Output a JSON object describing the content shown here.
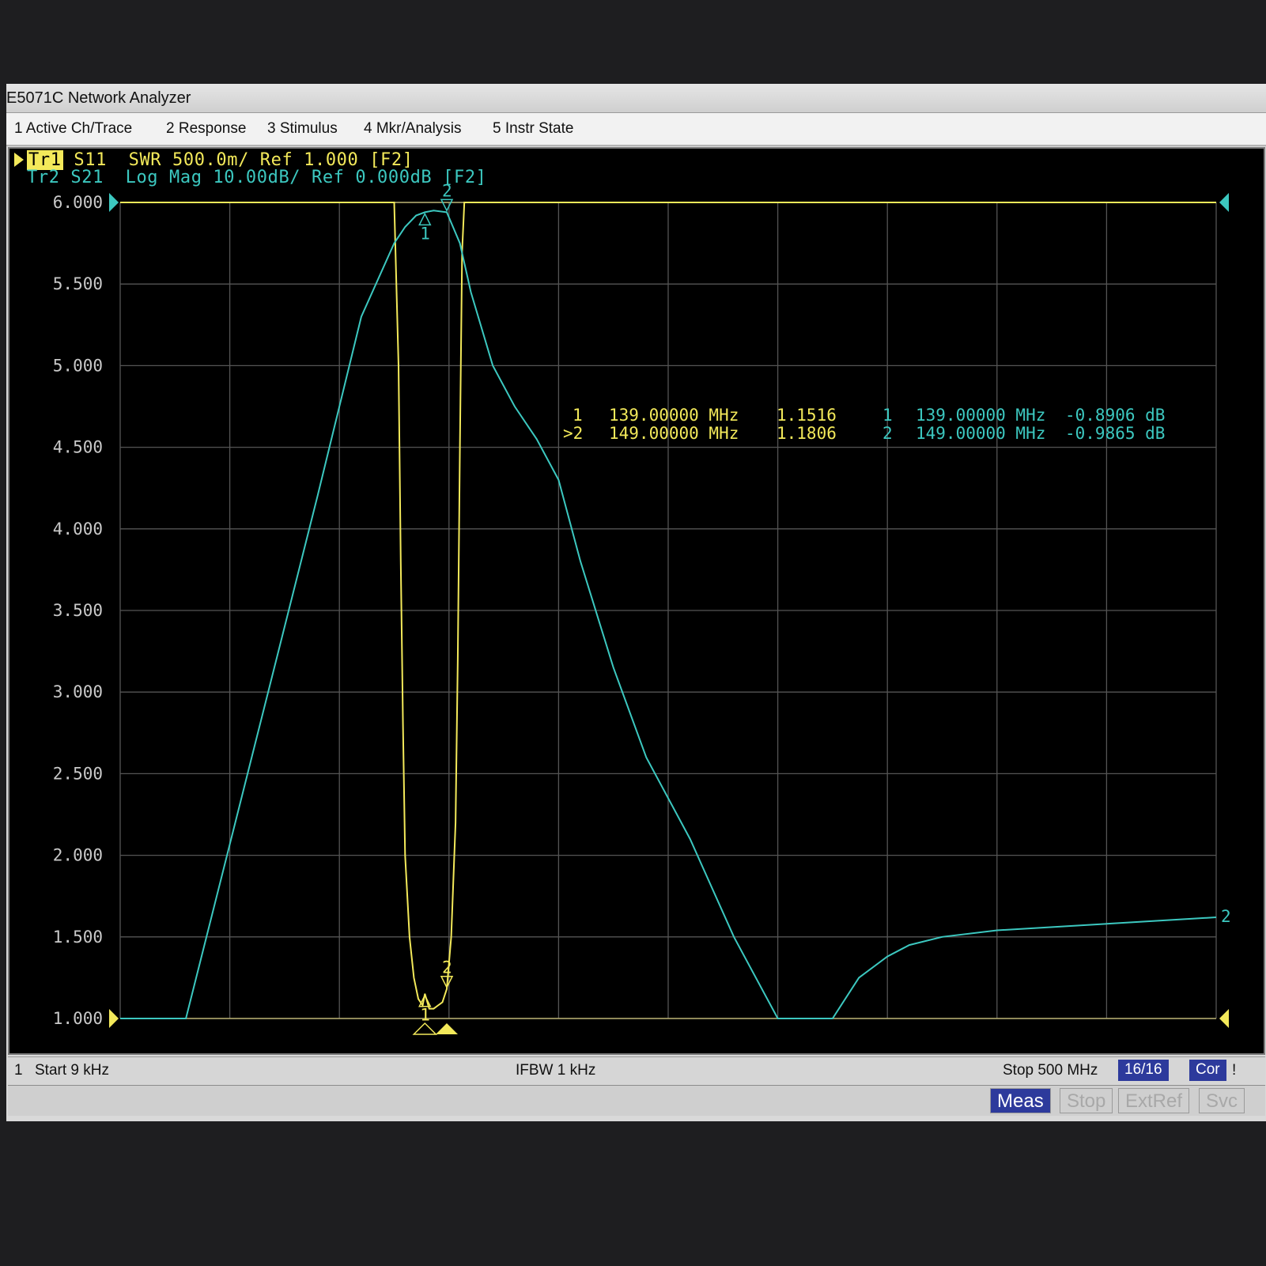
{
  "window": {
    "title": "E5071C Network Analyzer"
  },
  "menu": [
    {
      "label": "1 Active Ch/Trace"
    },
    {
      "label": "2 Response"
    },
    {
      "label": "3 Stimulus"
    },
    {
      "label": "4 Mkr/Analysis"
    },
    {
      "label": "5 Instr State"
    }
  ],
  "traces": {
    "tr1": {
      "tag": "Tr1",
      "text": " S11  SWR 500.0m/ Ref 1.000 [F2]"
    },
    "tr2": {
      "tag": "Tr2",
      "text": " S21  Log Mag 10.00dB/ Ref 0.000dB [F2]"
    }
  },
  "colors": {
    "tr1": "#f3e95a",
    "tr2": "#3cc8c0",
    "grid": "#5a5a5a",
    "background": "#000000",
    "chip": "#2d3a9c"
  },
  "markers_table": {
    "tr1": [
      {
        "id": "1",
        "freq": "139.00000 MHz",
        "value": "1.1516"
      },
      {
        "id": ">2",
        "freq": "149.00000 MHz",
        "value": "1.1806"
      }
    ],
    "tr2": [
      {
        "id": "1",
        "freq": "139.00000 MHz",
        "value": "-0.8906 dB"
      },
      {
        "id": "2",
        "freq": "149.00000 MHz",
        "value": "-0.9865 dB"
      }
    ]
  },
  "status": {
    "channel": "1",
    "start": "Start 9 kHz",
    "ifbw": "IFBW 1 kHz",
    "stop": "Stop 500 MHz",
    "points": "16/16",
    "cor": "Cor",
    "extra": "!"
  },
  "softkeys": [
    {
      "label": "Meas",
      "active": true
    },
    {
      "label": "Stop",
      "active": false
    },
    {
      "label": "ExtRef",
      "active": false
    },
    {
      "label": "Svc",
      "active": false
    }
  ],
  "chart_data": {
    "type": "line",
    "xlim": [
      0.009,
      500
    ],
    "ylim": [
      1.0,
      6.0
    ],
    "y_ticks": [
      "6.000",
      "5.500",
      "5.000",
      "4.500",
      "4.000",
      "3.500",
      "3.000",
      "2.500",
      "2.000",
      "1.500",
      "1.000"
    ],
    "grid": true,
    "series": [
      {
        "name": "Tr1",
        "x": [
          0.009,
          125,
          127,
          128,
          129,
          130,
          132,
          134,
          136,
          138,
          139,
          141,
          143,
          145,
          147,
          149,
          151,
          153,
          154,
          155,
          156,
          157,
          500
        ],
        "y": [
          6.0,
          6.0,
          5.0,
          3.8,
          2.8,
          2.0,
          1.5,
          1.25,
          1.12,
          1.08,
          1.1516,
          1.06,
          1.06,
          1.08,
          1.1,
          1.1806,
          1.5,
          2.2,
          3.2,
          4.5,
          5.7,
          6.0,
          6.0
        ]
      },
      {
        "name": "Tr2",
        "x": [
          0.009,
          30,
          60,
          90,
          110,
          125,
          130,
          135,
          139,
          143,
          149,
          155,
          160,
          170,
          180,
          190,
          200,
          210,
          225,
          240,
          260,
          280,
          300,
          315,
          325,
          337,
          350,
          360,
          375,
          400,
          450,
          500
        ],
        "y": [
          1.0,
          1.0,
          2.6,
          4.2,
          5.3,
          5.75,
          5.85,
          5.92,
          5.94,
          5.95,
          5.94,
          5.75,
          5.45,
          5.0,
          4.75,
          4.55,
          4.3,
          3.8,
          3.15,
          2.6,
          2.1,
          1.5,
          1.0,
          1.0,
          1.0,
          1.25,
          1.38,
          1.45,
          1.5,
          1.54,
          1.58,
          1.62
        ]
      }
    ],
    "markers": [
      {
        "trace": "Tr1",
        "id": "1",
        "x": 139,
        "y": 1.1516
      },
      {
        "trace": "Tr1",
        "id": "2",
        "x": 149,
        "y": 1.1806
      },
      {
        "trace": "Tr2",
        "id": "1",
        "x": 139,
        "y": 5.94
      },
      {
        "trace": "Tr2",
        "id": "2",
        "x": 149,
        "y": 5.94
      }
    ]
  }
}
